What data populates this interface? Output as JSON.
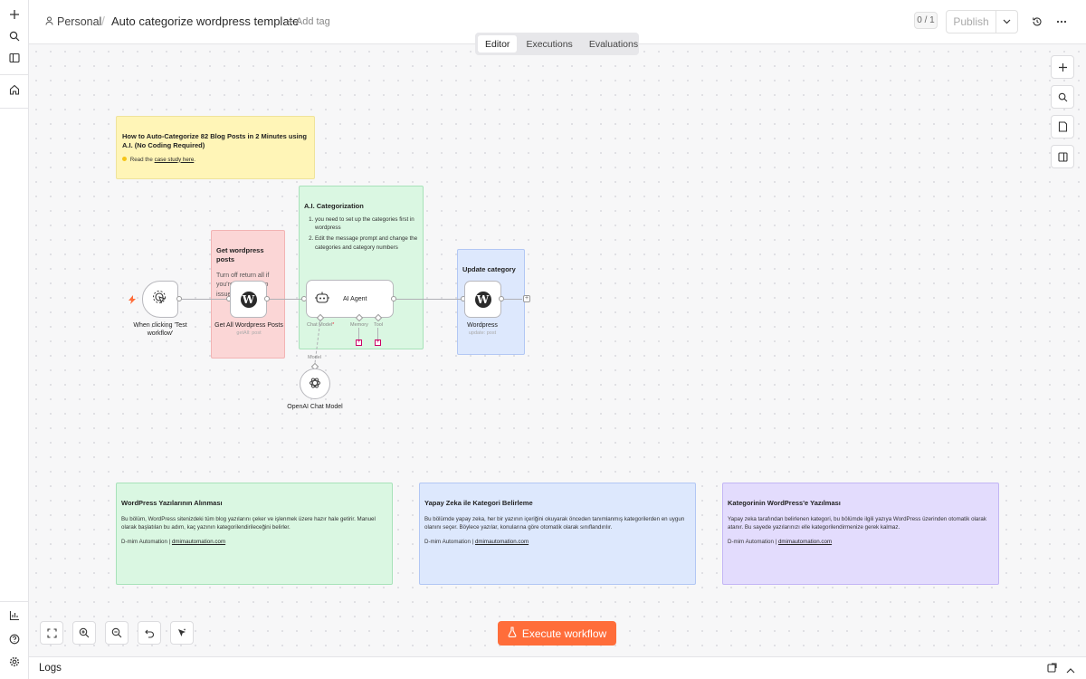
{
  "header": {
    "workspace": "Personal",
    "workflow_title": "Auto categorize wordpress template",
    "add_tag": "+ Add tag",
    "counter": "0 / 1",
    "publish_label": "Publish"
  },
  "tabs": [
    {
      "label": "Editor",
      "active": true
    },
    {
      "label": "Executions",
      "active": false
    },
    {
      "label": "Evaluations",
      "active": false
    }
  ],
  "sticky_notes": {
    "intro": {
      "title": "How to Auto-Categorize 82 Blog Posts in 2 Minutes using A.I. (No Coding Required)",
      "read_prefix": "Read the",
      "read_link": "case study here",
      "read_suffix": "."
    },
    "get_posts": {
      "title": "Get wordpress posts",
      "text": "Turn off return all if you're running into issues"
    },
    "ai_cat": {
      "title": "A.I. Categorization",
      "items": [
        "you need to set up the categories first in wordpress",
        "Edit the message prompt and change the categories and category numbers"
      ]
    },
    "update": {
      "title": "Update category"
    },
    "tr1": {
      "title": "WordPress Yazılarının Alınması",
      "text": "Bu bölüm, WordPress sitenizdeki tüm blog yazılarını çeker ve işlenmek üzere hazır hale getirir. Manuel olarak başlatılan bu adım, kaç yazının kategorilendirileceğini belirler.",
      "credit_prefix": "D-mim Automation |",
      "credit_link": "dmimautomation.com"
    },
    "tr2": {
      "title": "Yapay Zeka ile Kategori Belirleme",
      "text": "Bu bölümde yapay zeka, her bir yazının içeriğini okuyarak önceden tanımlanmış kategorilerden en uygun olanını seçer. Böylece yazılar, konularına göre otomatik olarak sınıflandırılır.",
      "credit_prefix": "D-mim Automation |",
      "credit_link": "dmimautomation.com"
    },
    "tr3": {
      "title": "Kategorinin WordPress'e Yazılması",
      "text": "Yapay zeka tarafından belirlenen kategori, bu bölümde ilgili yazıya WordPress üzerinden otomatik olarak atanır. Bu sayede yazılarınızı elle kategorilendirmenize gerek kalmaz.",
      "credit_prefix": "D-mim Automation |",
      "credit_link": "dmimautomation.com"
    }
  },
  "nodes": {
    "trigger": {
      "label": "When clicking 'Test workflow'"
    },
    "get_posts": {
      "label": "Get All Wordpress Posts",
      "sub": "getAll: post"
    },
    "agent": {
      "label": "AI Agent",
      "chat_model": "Chat Model",
      "required_mark": "*",
      "memory": "Memory",
      "tool": "Tool"
    },
    "openai": {
      "label": "OpenAI Chat Model",
      "model_port": "Model"
    },
    "wordpress": {
      "label": "Wordpress",
      "sub": "update: post"
    }
  },
  "footer": {
    "execute_label": "Execute workflow",
    "logs_label": "Logs"
  },
  "colors": {
    "accent": "#ff6d3a",
    "note_yellow": "#fff5b7",
    "note_red": "#fbd6d6",
    "note_green": "#daf7e2",
    "note_blue": "#dde8fd",
    "note_purple": "#e3dcfd"
  }
}
